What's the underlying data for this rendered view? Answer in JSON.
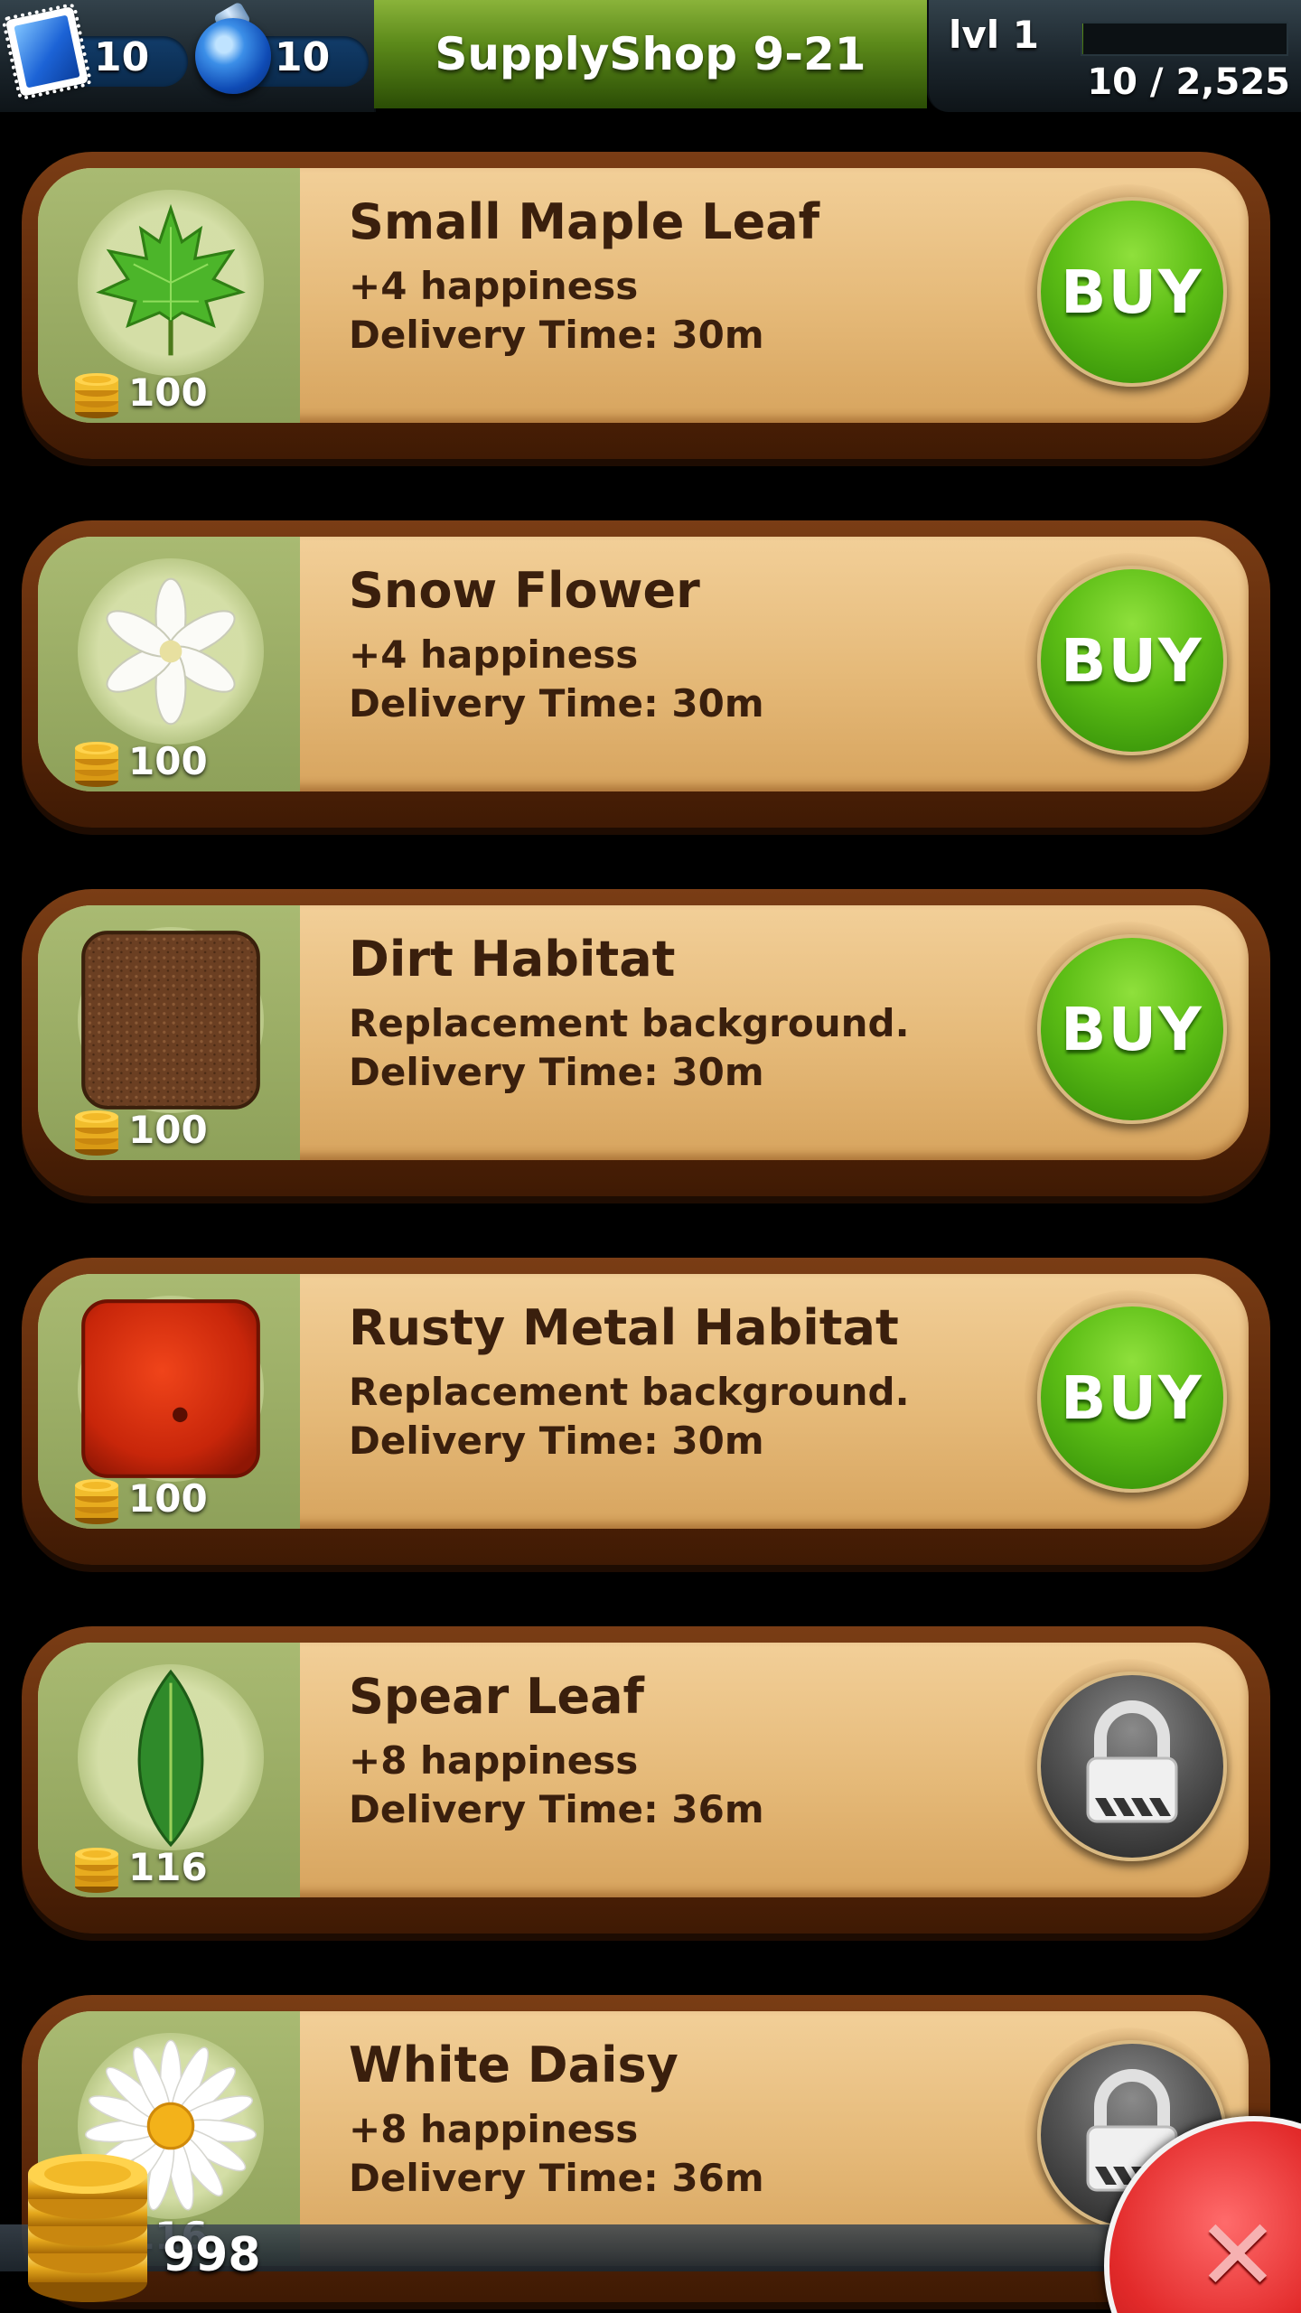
{
  "top_bar": {
    "stamps_count": "10",
    "potions_count": "10",
    "shop_title": "SupplyShop 9-21",
    "level_label": "lvl 1",
    "xp_text": "10 / 2,525",
    "xp_fraction": 0.004
  },
  "items": [
    {
      "name": "Small Maple Leaf",
      "desc": "+4 happiness",
      "delivery": "Delivery Time: 30m",
      "price": "100",
      "icon": "maple-leaf-icon",
      "action": "BUY"
    },
    {
      "name": "Snow Flower",
      "desc": "+4 happiness",
      "delivery": "Delivery Time: 30m",
      "price": "100",
      "icon": "snow-flower-icon",
      "action": "BUY"
    },
    {
      "name": "Dirt Habitat",
      "desc": "Replacement background.",
      "delivery": "Delivery Time: 30m",
      "price": "100",
      "icon": "dirt-habitat-icon",
      "action": "BUY"
    },
    {
      "name": "Rusty Metal Habitat",
      "desc": "Replacement background.",
      "delivery": "Delivery Time: 30m",
      "price": "100",
      "icon": "rusty-metal-habitat-icon",
      "action": "BUY"
    },
    {
      "name": "Spear Leaf",
      "desc": "+8 happiness",
      "delivery": "Delivery Time: 36m",
      "price": "116",
      "icon": "spear-leaf-icon",
      "action": "locked"
    },
    {
      "name": "White Daisy",
      "desc": "+8 happiness",
      "delivery": "Delivery Time: 36m",
      "price": "116",
      "icon": "white-daisy-icon",
      "action": "locked"
    }
  ],
  "wallet": {
    "coins": "998"
  },
  "colors": {
    "title_green": "#5c8a1a",
    "buy_green": "#5dbe16",
    "card_wood": "#5a2608",
    "card_parchment": "#e5b978",
    "close_red": "#e22a2a"
  }
}
